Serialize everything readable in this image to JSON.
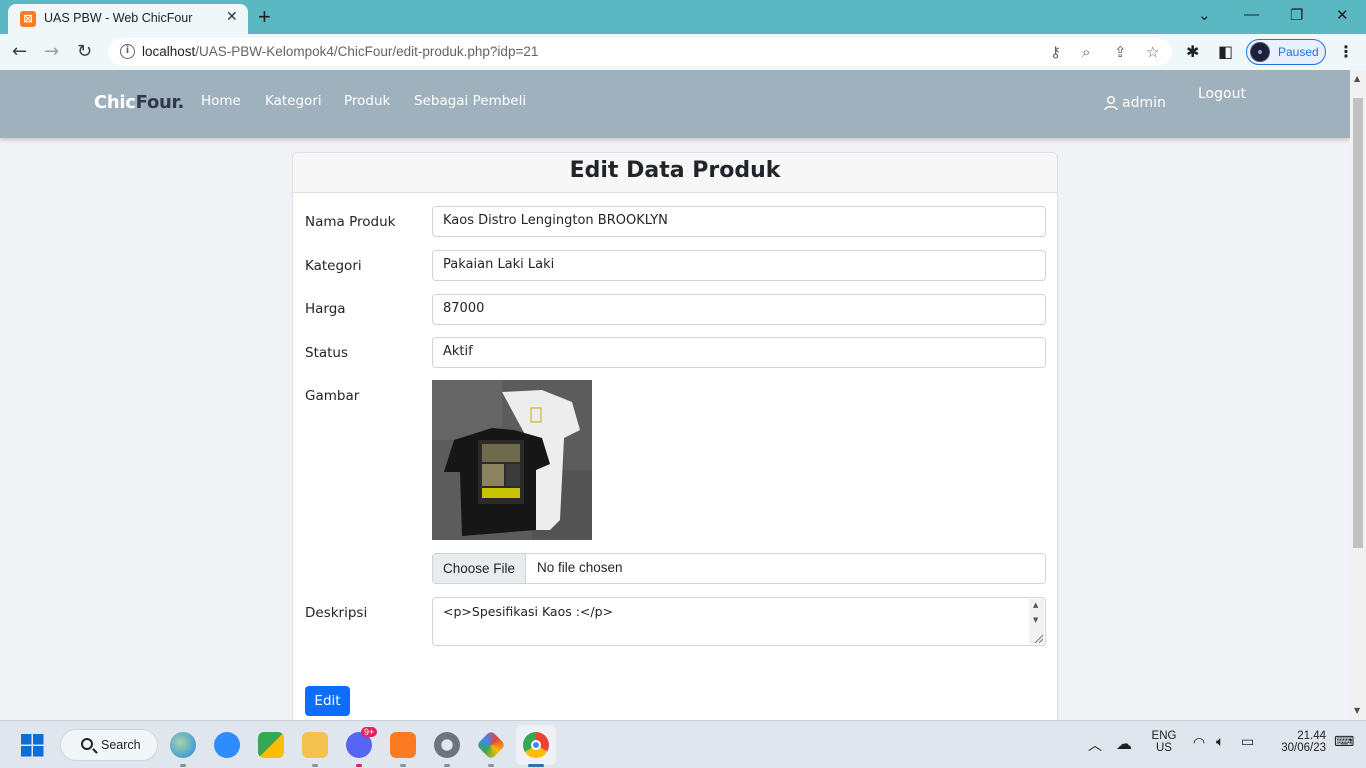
{
  "browser": {
    "tab_title": "UAS PBW - Web ChicFour",
    "url_host": "localhost",
    "url_path": "/UAS-PBW-Kelompok4/ChicFour/edit-produk.php?idp=21",
    "profile_status": "Paused"
  },
  "site": {
    "brand_main": "Chic",
    "brand_accent": "Four.",
    "nav": [
      "Home",
      "Kategori",
      "Produk",
      "Sebagai Pembeli"
    ],
    "user": "admin",
    "logout": "Logout"
  },
  "form": {
    "title": "Edit Data Produk",
    "fields": [
      {
        "label": "Nama Produk",
        "value": "Kaos Distro Lengington BROOKLYN"
      },
      {
        "label": "Kategori",
        "value": "Pakaian Laki Laki"
      },
      {
        "label": "Harga",
        "value": "87000"
      },
      {
        "label": "Status",
        "value": "Aktif"
      }
    ],
    "image_label": "Gambar",
    "file_button": "Choose File",
    "file_status": "No file chosen",
    "description_label": "Deskripsi",
    "description_value": "<p>Spesifikasi Kaos :</p>",
    "submit_label": "Edit"
  },
  "taskbar": {
    "search_label": "Search",
    "discord_badge": "9+",
    "lang_top": "ENG",
    "lang_bottom": "US",
    "time": "21.44",
    "date": "30/06/23"
  },
  "colors": {
    "nav_bg": "#9fb1bd",
    "primary": "#0d6efd",
    "tabbar": "#5ab8c3"
  }
}
